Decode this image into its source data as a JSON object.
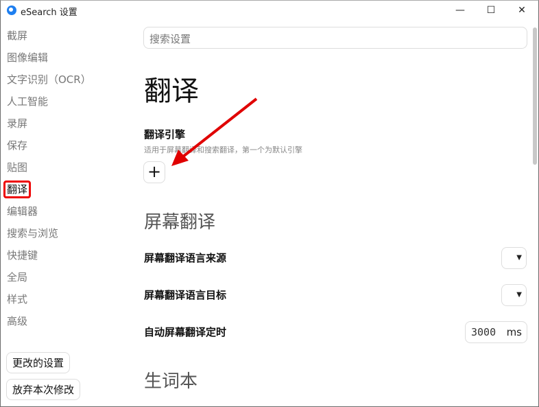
{
  "window": {
    "title": "eSearch 设置",
    "minimize": "—",
    "maximize": "☐",
    "close": "✕"
  },
  "sidebar": {
    "items": [
      "截屏",
      "图像编辑",
      "文字识别（OCR）",
      "人工智能",
      "录屏",
      "保存",
      "贴图",
      "翻译",
      "编辑器",
      "搜索与浏览",
      "快捷键",
      "全局",
      "样式",
      "高级"
    ],
    "active_index": 7,
    "changed_button": "更改的设置",
    "discard_button": "放弃本次修改"
  },
  "search": {
    "placeholder": "搜索设置"
  },
  "main": {
    "title": "翻译",
    "engine_label": "翻译引擎",
    "engine_desc": "适用于屏幕翻译和搜索翻译，第一个为默认引擎",
    "add_button": "+",
    "screen_title": "屏幕翻译",
    "source_label": "屏幕翻译语言来源",
    "target_label": "屏幕翻译语言目标",
    "auto_label": "自动屏幕翻译定时",
    "auto_value": "3000",
    "auto_unit": "ms",
    "vocab_title": "生词本"
  },
  "annotation_color": "#e00000"
}
